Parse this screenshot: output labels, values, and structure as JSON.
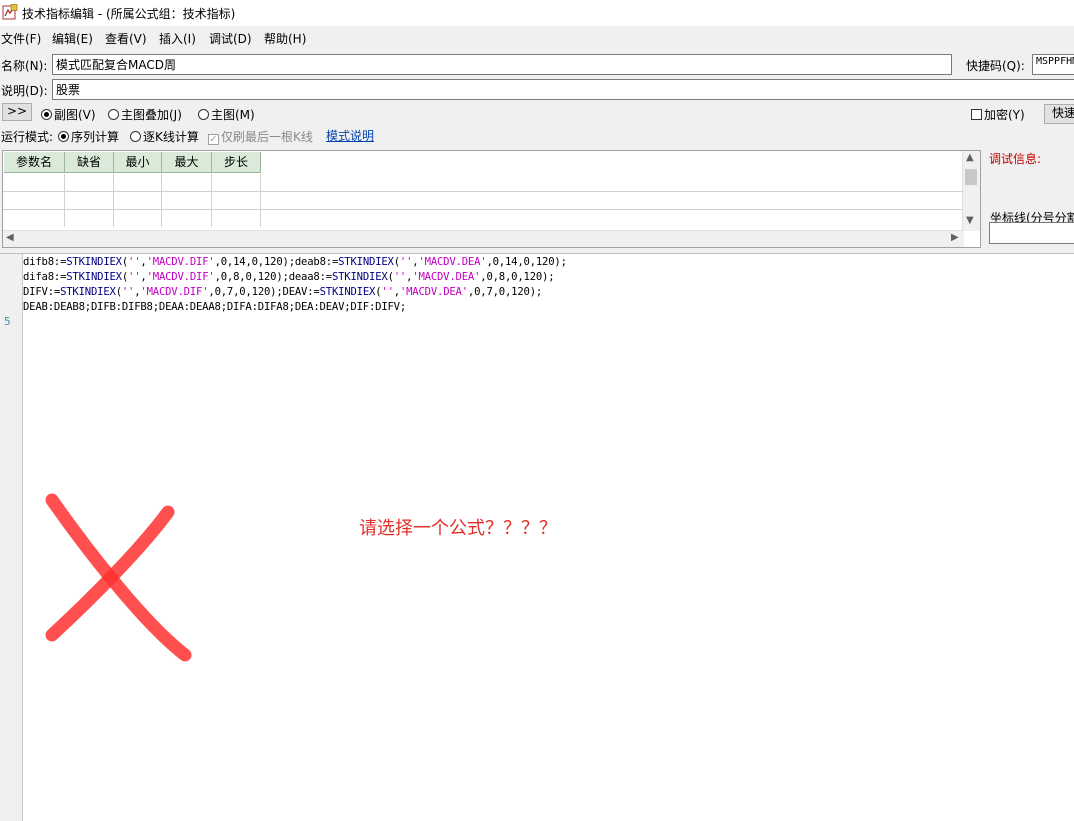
{
  "window": {
    "title": "技术指标编辑 - (所属公式组：技术指标)"
  },
  "menu": [
    "文件(F)",
    "编辑(E)",
    "查看(V)",
    "插入(I)",
    "调试(D)",
    "帮助(H)"
  ],
  "form": {
    "name_label": "名称(N):",
    "name_value": "模式匹配复合MACD周",
    "shortcut_label": "快捷码(Q):",
    "shortcut_value": "MSPPFHM",
    "desc_label": "说明(D):",
    "desc_value": "股票",
    "expand_button": ">>",
    "chart_options": [
      {
        "label": "副图(V)",
        "selected": true
      },
      {
        "label": "主图叠加(J)",
        "selected": false
      },
      {
        "label": "主图(M)",
        "selected": false
      }
    ],
    "encrypt_label": "加密(Y)",
    "quick_button": "快速",
    "run_mode_label": "运行模式:",
    "run_modes": [
      {
        "label": "序列计算",
        "selected": true
      },
      {
        "label": "逐K线计算",
        "selected": false
      }
    ],
    "refresh_last_label": "仅刷最后一根K线",
    "mode_help_link": "模式说明"
  },
  "param_table": {
    "headers": [
      "参数名",
      "缺省",
      "最小",
      "最大",
      "步长"
    ],
    "rows": 3
  },
  "right_panel": {
    "debug_label": "调试信息:",
    "axis_label": "坐标线(分号分割"
  },
  "code": {
    "lines": [
      [
        {
          "t": "difb8:=",
          "c": "plain"
        },
        {
          "t": "STKINDIEX",
          "c": "fn"
        },
        {
          "t": "(",
          "c": "plain"
        },
        {
          "t": "''",
          "c": "str"
        },
        {
          "t": ",",
          "c": "plain"
        },
        {
          "t": "'MACDV.DIF'",
          "c": "str"
        },
        {
          "t": ",0,14,0,120);deab8:=",
          "c": "plain"
        },
        {
          "t": "STKINDIEX",
          "c": "fn"
        },
        {
          "t": "(",
          "c": "plain"
        },
        {
          "t": "''",
          "c": "str"
        },
        {
          "t": ",",
          "c": "plain"
        },
        {
          "t": "'MACDV.DEA'",
          "c": "str"
        },
        {
          "t": ",0,14,0,120);",
          "c": "plain"
        }
      ],
      [
        {
          "t": "difa8:=",
          "c": "plain"
        },
        {
          "t": "STKINDIEX",
          "c": "fn"
        },
        {
          "t": "(",
          "c": "plain"
        },
        {
          "t": "''",
          "c": "str"
        },
        {
          "t": ",",
          "c": "plain"
        },
        {
          "t": "'MACDV.DIF'",
          "c": "str"
        },
        {
          "t": ",0,8,0,120);deaa8:=",
          "c": "plain"
        },
        {
          "t": "STKINDIEX",
          "c": "fn"
        },
        {
          "t": "(",
          "c": "plain"
        },
        {
          "t": "''",
          "c": "str"
        },
        {
          "t": ",",
          "c": "plain"
        },
        {
          "t": "'MACDV.DEA'",
          "c": "str"
        },
        {
          "t": ",0,8,0,120);",
          "c": "plain"
        }
      ],
      [
        {
          "t": "DIFV:=",
          "c": "plain"
        },
        {
          "t": "STKINDIEX",
          "c": "fn"
        },
        {
          "t": "(",
          "c": "plain"
        },
        {
          "t": "''",
          "c": "str"
        },
        {
          "t": ",",
          "c": "plain"
        },
        {
          "t": "'MACDV.DIF'",
          "c": "str"
        },
        {
          "t": ",0,7,0,120);DEAV:=",
          "c": "plain"
        },
        {
          "t": "STKINDIEX",
          "c": "fn"
        },
        {
          "t": "(",
          "c": "plain"
        },
        {
          "t": "''",
          "c": "str"
        },
        {
          "t": ",",
          "c": "plain"
        },
        {
          "t": "'MACDV.DEA'",
          "c": "str"
        },
        {
          "t": ",0,7,0,120);",
          "c": "plain"
        }
      ],
      [
        {
          "t": "DEAB:DEAB8;DIFB:DIFB8;DEAA:DEAA8;DIFA:DIFA8;DEA:DEAV;DIF:DIFV;",
          "c": "plain"
        }
      ]
    ],
    "current_line_number": "5"
  },
  "overlay_message": "请选择一个公式？？？？",
  "colors": {
    "debug_label": "#c00000",
    "overlay": "#e0302a",
    "string": "#c000c0",
    "function": "#000080"
  }
}
